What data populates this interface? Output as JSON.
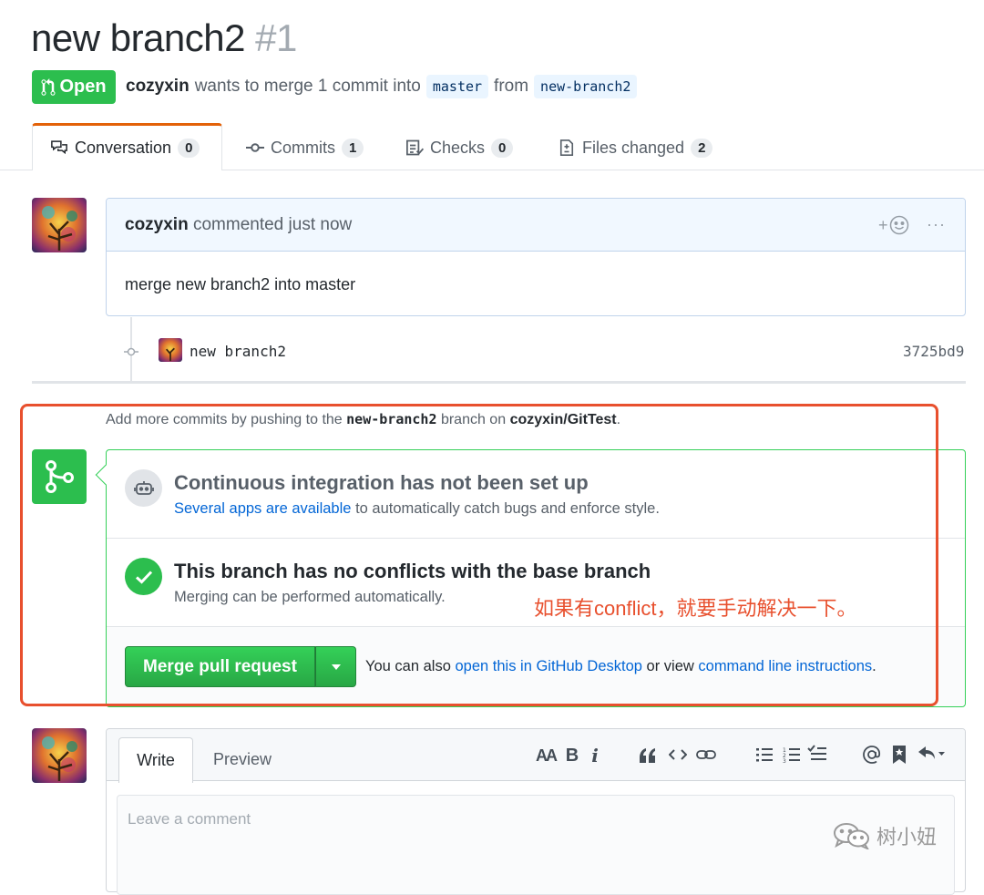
{
  "pr": {
    "title": "new branch2",
    "number": "#1",
    "state": "Open",
    "author": "cozyxin",
    "merge_text": "wants to merge 1 commit into",
    "base_branch": "master",
    "from_text": "from",
    "head_branch": "new-branch2"
  },
  "tabs": [
    {
      "label": "Conversation",
      "count": "0",
      "icon": "comment-discussion-icon"
    },
    {
      "label": "Commits",
      "count": "1",
      "icon": "git-commit-icon"
    },
    {
      "label": "Checks",
      "count": "0",
      "icon": "checklist-icon"
    },
    {
      "label": "Files changed",
      "count": "2",
      "icon": "file-diff-icon"
    }
  ],
  "comment": {
    "author": "cozyxin",
    "action": "commented just now",
    "body": "merge new branch2 into master",
    "reaction_plus": "+",
    "more": "···"
  },
  "commit": {
    "message": "new branch2",
    "sha": "3725bd9"
  },
  "merge": {
    "hint_pre": "Add more commits by pushing to the",
    "hint_branch": "new-branch2",
    "hint_mid": "branch on",
    "hint_repo": "cozyxin/GitTest",
    "hint_end": ".",
    "ci_title": "Continuous integration has not been set up",
    "ci_link": "Several apps are available",
    "ci_rest": "to automatically catch bugs and enforce style.",
    "ok_title": "This branch has no conflicts with the base branch",
    "ok_desc": "Merging can be performed automatically.",
    "button_label": "Merge pull request",
    "also_pre": "You can also",
    "also_link1": "open this in GitHub Desktop",
    "also_mid": "or view",
    "also_link2": "command line instructions",
    "also_end": "."
  },
  "annotation": {
    "note": "如果有conflict，就要手动解决一下。",
    "color": "#e8502e"
  },
  "editor": {
    "write_tab": "Write",
    "preview_tab": "Preview",
    "placeholder": "Leave a comment",
    "toolbar": {
      "header": "AA",
      "bold": "B",
      "italic": "i"
    }
  },
  "watermark": "树小妞",
  "colors": {
    "green": "#2cbe4e",
    "link": "#0366d6",
    "accent_tab": "#e36209"
  }
}
